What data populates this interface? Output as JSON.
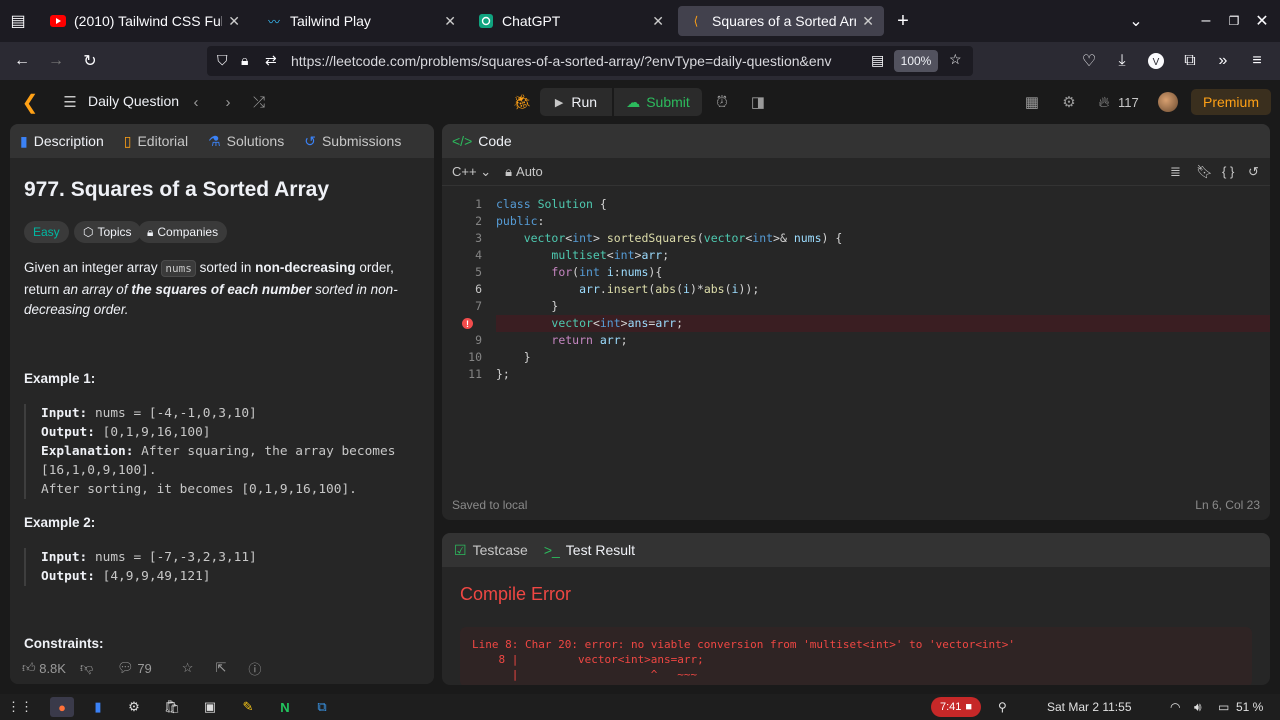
{
  "browser": {
    "tabs": [
      {
        "title": "(2010) Tailwind CSS Full C",
        "icon": "youtube-icon"
      },
      {
        "title": "Tailwind Play",
        "icon": "tailwind-icon"
      },
      {
        "title": "ChatGPT",
        "icon": "chatgpt-icon"
      },
      {
        "title": "Squares of a Sorted Array",
        "icon": "leetcode-icon",
        "active": true
      }
    ],
    "url": "https://leetcode.com/problems/squares-of-a-sorted-array/?envType=daily-question&env",
    "zoom": "100%",
    "colors": {
      "tabbar": "#1c1b22",
      "navbar": "#2b2a33"
    }
  },
  "topbar": {
    "daily_label": "Daily Question",
    "run_label": "Run",
    "submit_label": "Submit",
    "streak_count": "117",
    "premium_label": "Premium"
  },
  "left": {
    "tabs": [
      {
        "label": "Description",
        "icon": "doc-icon"
      },
      {
        "label": "Editorial",
        "icon": "book-icon"
      },
      {
        "label": "Solutions",
        "icon": "flask-icon"
      },
      {
        "label": "Submissions",
        "icon": "history-icon"
      }
    ],
    "title": "977. Squares of a Sorted Array",
    "difficulty": "Easy",
    "topics_label": "Topics",
    "companies_label": "Companies",
    "desc": {
      "p1": "Given an integer array ",
      "code": "nums",
      "p2": " sorted in ",
      "b1": "non-decreasing",
      "p3": " order, return ",
      "i1": "an array of ",
      "bi1": "the squares of each number",
      "i2": " sorted in non-decreasing order."
    },
    "example1": {
      "heading": "Example 1:",
      "input_label": "Input:",
      "input_value": " nums = [-4,-1,0,3,10]",
      "output_label": "Output:",
      "output_value": " [0,1,9,16,100]",
      "explanation_label": "Explanation:",
      "explanation_value": " After squaring, the array becomes [16,1,0,9,100].",
      "explanation_value2": "After sorting, it becomes [0,1,9,16,100]."
    },
    "example2": {
      "heading": "Example 2:",
      "input_label": "Input:",
      "input_value": " nums = [-7,-3,2,3,11]",
      "output_label": "Output:",
      "output_value": " [4,9,9,49,121]"
    },
    "constraints_heading": "Constraints:",
    "footer": {
      "likes": "8.8K",
      "comments": "79"
    }
  },
  "code": {
    "tab_label": "Code",
    "language": "C++",
    "mode": "Auto",
    "lines": [
      "1",
      "2",
      "3",
      "4",
      "5",
      "6",
      "7",
      "8",
      "9",
      "10",
      "11"
    ],
    "saved_label": "Saved to local",
    "cursor_pos": "Ln 6, Col 23",
    "error_line": "8",
    "error_marker": "!"
  },
  "result": {
    "testcase_label": "Testcase",
    "result_label": "Test Result",
    "status": "Compile Error",
    "error_text": "Line 8: Char 20: error: no viable conversion from 'multiset<int>' to 'vector<int>'",
    "error_line2": "    8 |         vector<int>ans=arr;",
    "error_line3": "      |                    ^   ~~~"
  },
  "taskbar": {
    "badge_time": "7:41",
    "datetime": "Sat Mar 2  11:55",
    "battery": "51 %"
  }
}
